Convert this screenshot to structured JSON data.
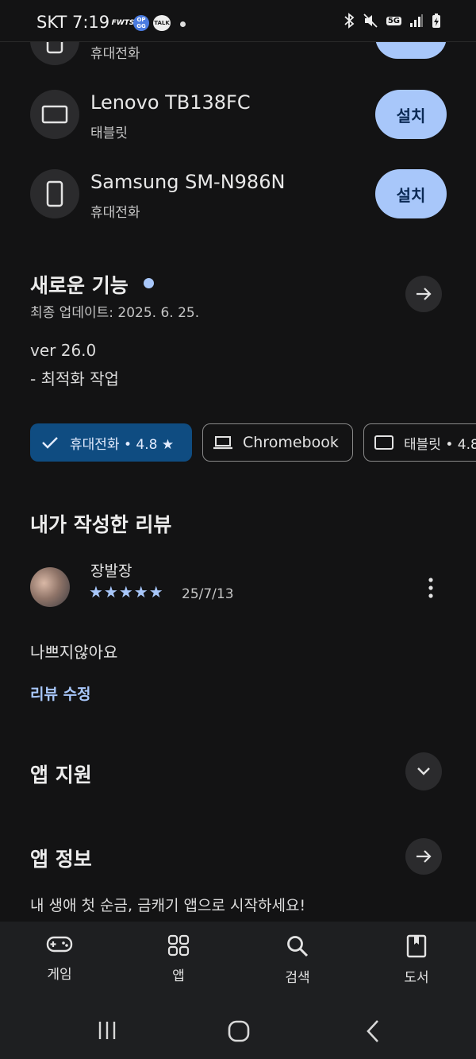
{
  "status_bar": {
    "carrier_time": "SKT 7:19",
    "app_badges": [
      "FWTS",
      "OP GG",
      "TALK"
    ],
    "network": "5G"
  },
  "devices": [
    {
      "name": "Lenovo TB138FC",
      "type": "태블릿",
      "button": "설치",
      "icon": "tablet-icon"
    },
    {
      "name": "Samsung SM-N986N",
      "type": "휴대전화",
      "button": "설치",
      "icon": "phone-icon"
    }
  ],
  "partial_device": {
    "type": "휴대전화"
  },
  "whats_new": {
    "title": "새로운 기능",
    "updated": "최종 업데이트: 2025. 6. 25.",
    "version": "ver 26.0",
    "note": "- 최적화 작업"
  },
  "chips": [
    {
      "label": "휴대전화 • 4.8 ★",
      "selected": true
    },
    {
      "label": "Chromebook",
      "selected": false
    },
    {
      "label": "태블릿 • 4.8",
      "selected": false
    }
  ],
  "my_review": {
    "section_title": "내가 작성한 리뷰",
    "author": "장발장",
    "stars": "★★★★★",
    "rating": 5,
    "date": "25/7/13",
    "text": "나쁘지않아요",
    "edit_label": "리뷰 수정"
  },
  "app_support": {
    "title": "앱 지원"
  },
  "app_info": {
    "title": "앱 정보",
    "description": "내 생애 첫 순금, 금캐기 앱으로 시작하세요!"
  },
  "bottom_nav": [
    {
      "label": "게임",
      "icon": "gamepad-icon"
    },
    {
      "label": "앱",
      "icon": "apps-grid-icon"
    },
    {
      "label": "검색",
      "icon": "search-icon"
    },
    {
      "label": "도서",
      "icon": "book-icon"
    }
  ],
  "colors": {
    "background": "#131314",
    "accent": "#a8c7fa",
    "chip_selected": "#0f4c81",
    "link": "#a8c7fa"
  }
}
